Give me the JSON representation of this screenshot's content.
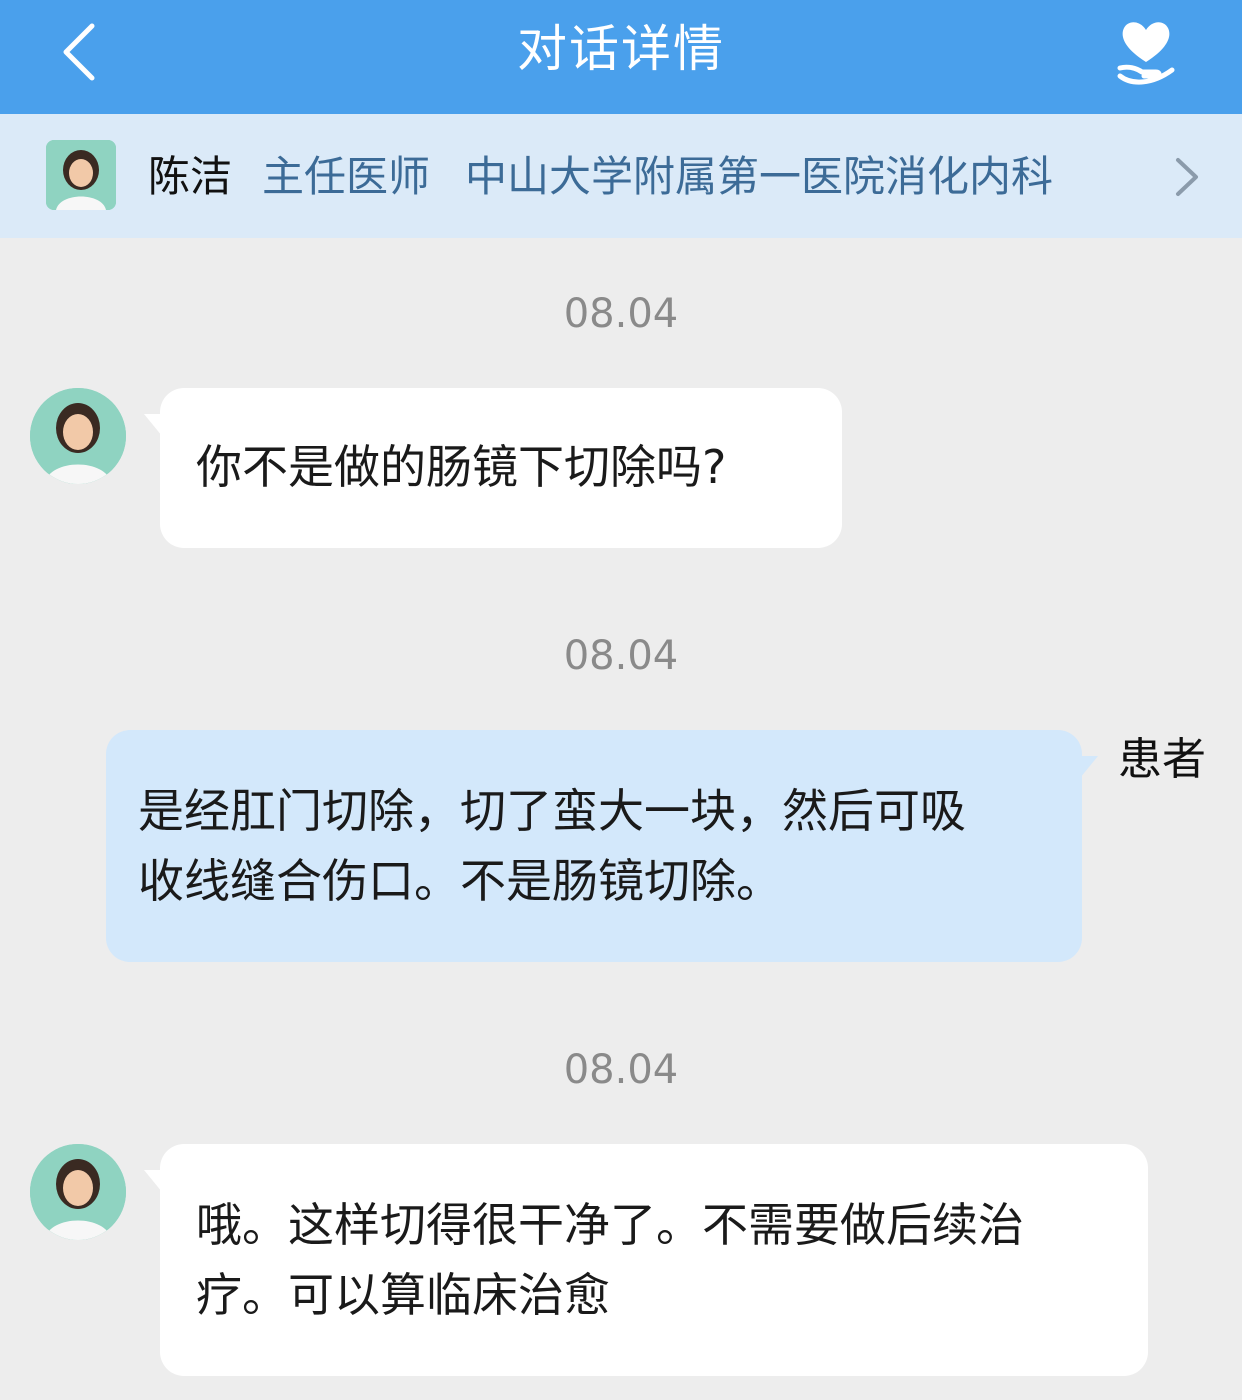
{
  "header": {
    "title": "对话详情",
    "back_icon": "chevron-left-icon",
    "action_icon": "heart-hand-icon"
  },
  "doctor": {
    "name": "陈洁",
    "title": "主任医师",
    "hospital": "中山大学附属第一医院消化内科",
    "chevron_icon": "chevron-right-icon"
  },
  "messages": [
    {
      "time": "08.04",
      "side": "left",
      "text": "你不是做的肠镜下切除吗?"
    },
    {
      "time": "08.04",
      "side": "right",
      "sender_label": "患者",
      "lines": [
        "是经肛门切除，切了蛮大一块，然后可吸",
        "收线缝合伤口。不是肠镜切除。"
      ]
    },
    {
      "time": "08.04",
      "side": "left",
      "lines": [
        "哦。这样切得很干净了。不需要做后续治",
        "疗。可以算临床治愈"
      ]
    }
  ],
  "colors": {
    "header_bg": "#4aa0ec",
    "doctor_bar_bg": "#dbeaf8",
    "chat_bg": "#ededed",
    "incoming_bubble": "#ffffff",
    "outgoing_bubble": "#d3e8fb"
  }
}
